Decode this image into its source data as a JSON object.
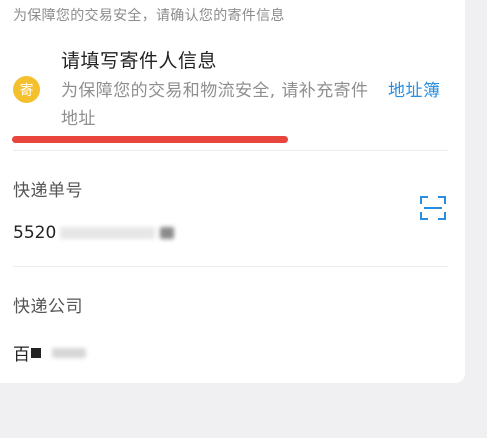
{
  "header": {
    "notice": "为保障您的交易安全，请确认您的寄件信息"
  },
  "sender": {
    "badge": "寄",
    "title": "请填写寄件人信息",
    "subtitle": "为保障您的交易和物流安全, 请补充寄件地址",
    "address_book": "地址簿"
  },
  "tracking": {
    "label": "快递单号",
    "value_visible": "5520"
  },
  "company": {
    "label": "快递公司",
    "value_visible": "百"
  },
  "colors": {
    "accent_blue": "#2a8ee0",
    "highlight_red": "#e8453c",
    "badge_yellow": "#f5c02e"
  },
  "icons": {
    "scan": "scan-icon"
  }
}
